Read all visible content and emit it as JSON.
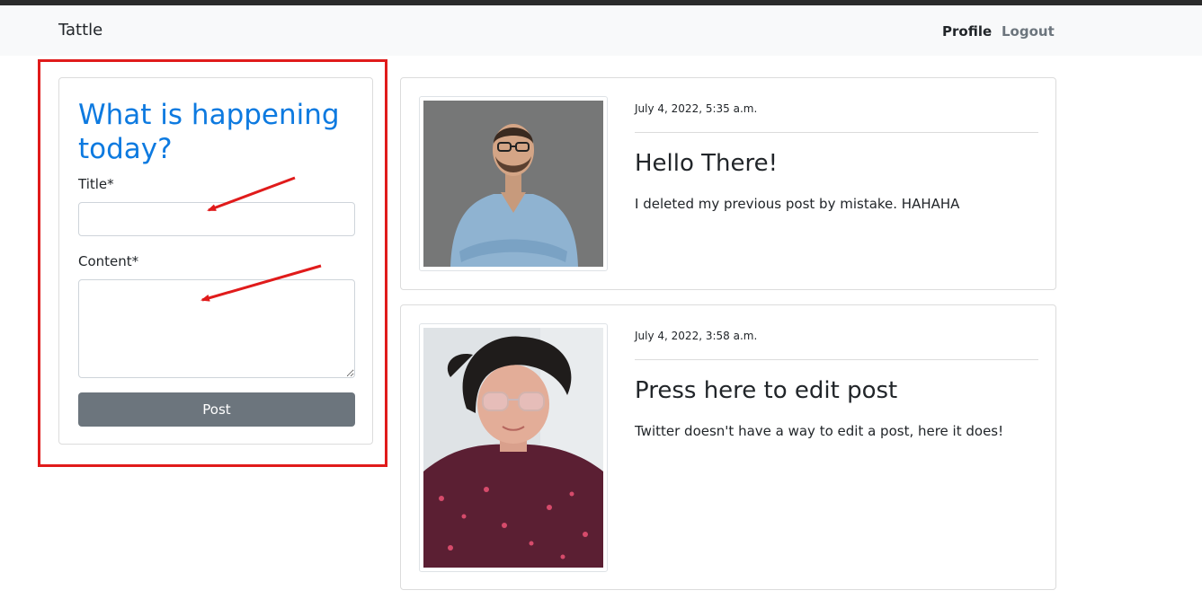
{
  "navbar": {
    "brand": "Tattle",
    "profile_label": "Profile",
    "logout_label": "Logout"
  },
  "form": {
    "heading": "What is happening today?",
    "title_label": "Title*",
    "title_value": "",
    "content_label": "Content*",
    "content_value": "",
    "post_button_label": "Post"
  },
  "posts": [
    {
      "date": "July 4, 2022, 5:35 a.m.",
      "title": "Hello There!",
      "content": "I deleted my previous post by mistake. HAHAHA"
    },
    {
      "date": "July 4, 2022, 3:58 a.m.",
      "title": "Press here to edit post",
      "content": "Twitter doesn't have a way to edit a post, here it does!"
    }
  ],
  "colors": {
    "heading_blue": "#0d7ae0",
    "button_gray": "#6c757d",
    "annotation_red": "#e01b1b",
    "navbar_bg": "#f8f9fa"
  }
}
